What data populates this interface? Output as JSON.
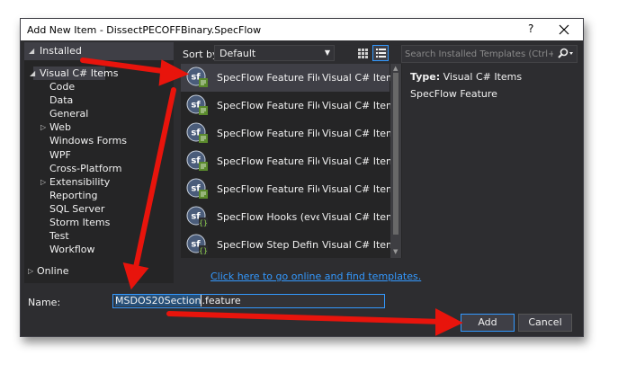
{
  "window": {
    "title": "Add New Item - DissectPECOFFBinary.SpecFlow",
    "help_glyph": "?",
    "close_glyph": "✕"
  },
  "tree": {
    "installed": "Installed",
    "visual_csharp_items": "Visual C# Items",
    "children": [
      {
        "label": "Code",
        "expandable": false
      },
      {
        "label": "Data",
        "expandable": false
      },
      {
        "label": "General",
        "expandable": false
      },
      {
        "label": "Web",
        "expandable": true
      },
      {
        "label": "Windows Forms",
        "expandable": false
      },
      {
        "label": "WPF",
        "expandable": false
      },
      {
        "label": "Cross-Platform",
        "expandable": false
      },
      {
        "label": "Extensibility",
        "expandable": true
      },
      {
        "label": "Reporting",
        "expandable": false
      },
      {
        "label": "SQL Server",
        "expandable": false
      },
      {
        "label": "Storm Items",
        "expandable": false
      },
      {
        "label": "Test",
        "expandable": false
      },
      {
        "label": "Workflow",
        "expandable": false
      }
    ],
    "online": "Online"
  },
  "toolbar": {
    "sort_by_label": "Sort by:",
    "sort_value": "Default"
  },
  "templates": [
    {
      "name": "SpecFlow Feature File",
      "language": "Visual C# Items",
      "icon": "specflow-feature-icon",
      "selected": true
    },
    {
      "name": "SpecFlow Feature File (Du...",
      "language": "Visual C# Items",
      "icon": "specflow-feature-icon",
      "selected": false
    },
    {
      "name": "SpecFlow Feature File (En...",
      "language": "Visual C# Items",
      "icon": "specflow-feature-icon",
      "selected": false
    },
    {
      "name": "SpecFlow Feature File (Fre...",
      "language": "Visual C# Items",
      "icon": "specflow-feature-icon",
      "selected": false
    },
    {
      "name": "SpecFlow Feature File (Ge...",
      "language": "Visual C# Items",
      "icon": "specflow-feature-icon",
      "selected": false
    },
    {
      "name": "SpecFlow Hooks (event bi...",
      "language": "Visual C# Items",
      "icon": "specflow-code-icon",
      "selected": false
    },
    {
      "name": "SpecFlow Step Definition",
      "language": "Visual C# Items",
      "icon": "specflow-code-icon",
      "selected": false
    }
  ],
  "online_link": "Click here to go online and find templates.",
  "search": {
    "placeholder": "Search Installed Templates (Ctrl+E)"
  },
  "details": {
    "type_label": "Type:",
    "type_value": "Visual C# Items",
    "description": "SpecFlow Feature"
  },
  "name_field": {
    "label": "Name:",
    "value_selected": "MSDOS20Section",
    "value_rest": ".feature"
  },
  "buttons": {
    "add": "Add",
    "cancel": "Cancel"
  },
  "colors": {
    "dialog_bg": "#2d2d30",
    "pane_bg": "#252526",
    "selection_bg": "#3f3f46",
    "accent": "#3399ff",
    "annotation_arrow": "#e8140c"
  }
}
